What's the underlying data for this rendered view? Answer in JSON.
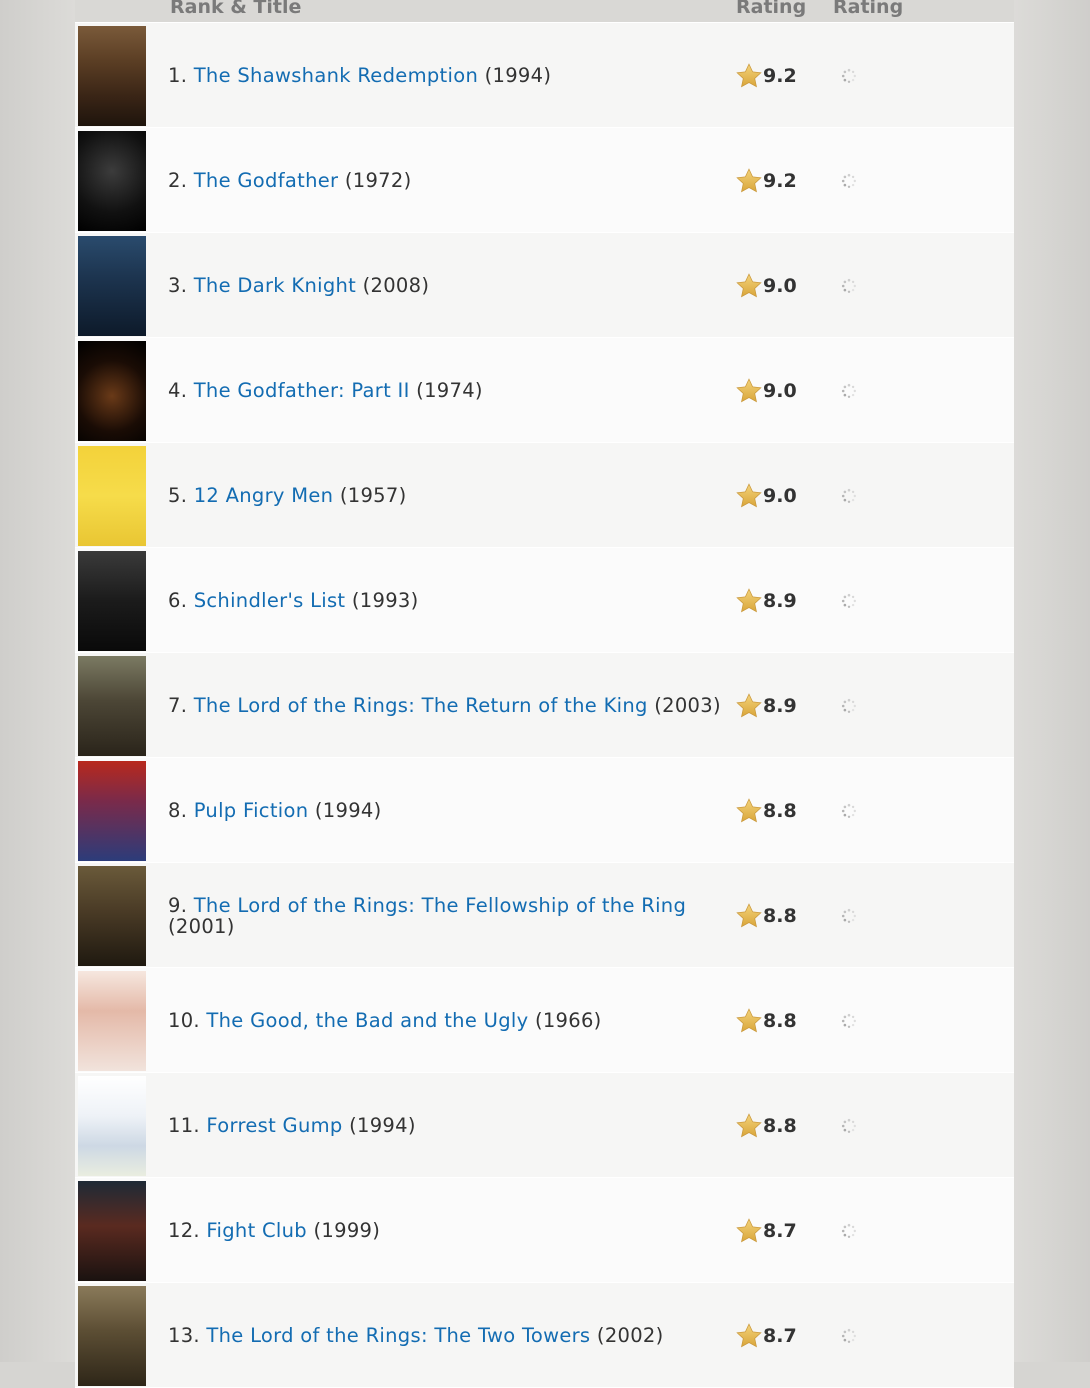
{
  "header": {
    "title_col": "Rank & Title",
    "imdb_col": "Rating",
    "your_col": "Rating"
  },
  "colors": {
    "link": "#136cb2",
    "star": "#f5c518",
    "text": "#333333"
  },
  "movies": [
    {
      "rank": "1.",
      "title": "The Shawshank Redemption",
      "year": "(1994)",
      "rating": "9.2",
      "poster_icon": "shawshank-poster"
    },
    {
      "rank": "2.",
      "title": "The Godfather",
      "year": "(1972)",
      "rating": "9.2",
      "poster_icon": "godfather-poster"
    },
    {
      "rank": "3.",
      "title": "The Dark Knight",
      "year": "(2008)",
      "rating": "9.0",
      "poster_icon": "dark-knight-poster"
    },
    {
      "rank": "4.",
      "title": "The Godfather: Part II",
      "year": "(1974)",
      "rating": "9.0",
      "poster_icon": "godfather-2-poster"
    },
    {
      "rank": "5.",
      "title": "12 Angry Men",
      "year": "(1957)",
      "rating": "9.0",
      "poster_icon": "12-angry-men-poster"
    },
    {
      "rank": "6.",
      "title": "Schindler's List",
      "year": "(1993)",
      "rating": "8.9",
      "poster_icon": "schindlers-list-poster"
    },
    {
      "rank": "7.",
      "title": "The Lord of the Rings: The Return of the King",
      "year": "(2003)",
      "rating": "8.9",
      "poster_icon": "lotr-return-poster"
    },
    {
      "rank": "8.",
      "title": "Pulp Fiction",
      "year": "(1994)",
      "rating": "8.8",
      "poster_icon": "pulp-fiction-poster"
    },
    {
      "rank": "9.",
      "title": "The Lord of the Rings: The Fellowship of the Ring",
      "year": "(2001)",
      "rating": "8.8",
      "poster_icon": "lotr-fellowship-poster"
    },
    {
      "rank": "10.",
      "title": "The Good, the Bad and the Ugly",
      "year": "(1966)",
      "rating": "8.8",
      "poster_icon": "good-bad-ugly-poster"
    },
    {
      "rank": "11.",
      "title": "Forrest Gump",
      "year": "(1994)",
      "rating": "8.8",
      "poster_icon": "forrest-gump-poster"
    },
    {
      "rank": "12.",
      "title": "Fight Club",
      "year": "(1999)",
      "rating": "8.7",
      "poster_icon": "fight-club-poster"
    },
    {
      "rank": "13.",
      "title": "The Lord of the Rings: The Two Towers",
      "year": "(2002)",
      "rating": "8.7",
      "poster_icon": "lotr-two-towers-poster"
    }
  ]
}
